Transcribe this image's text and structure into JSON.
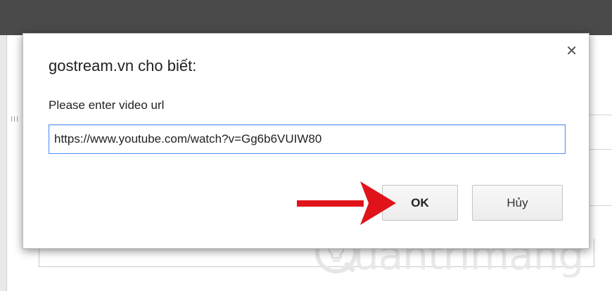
{
  "dialog": {
    "title": "gostream.vn cho biết:",
    "message": "Please enter video url",
    "input_value": "https://www.youtube.com/watch?v=Gg6b6VUIW80",
    "ok_label": "OK",
    "cancel_label": "Hủy",
    "close_icon": "close-icon"
  },
  "background": {
    "handle_text": "III"
  },
  "watermark": {
    "text": "uantrimang",
    "logo_icon": "lightbulb-icon"
  },
  "colors": {
    "arrow": "#e0131b",
    "input_focus_border": "#4d90fe",
    "topbar": "#4a4a4a"
  }
}
